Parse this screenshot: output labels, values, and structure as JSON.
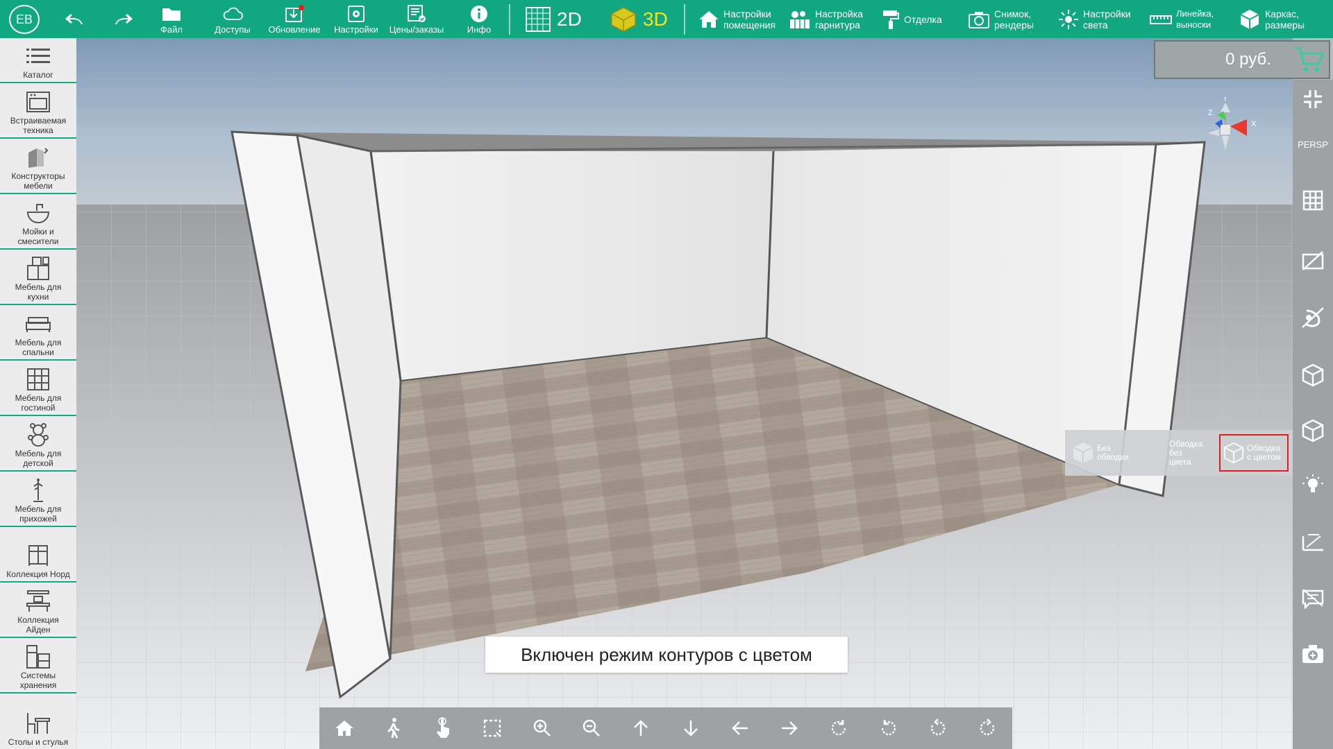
{
  "user": {
    "initials": "EB"
  },
  "topbar": {
    "file": "Файл",
    "access": "Доступы",
    "update": "Обновление",
    "settings": "Настройки",
    "prices": "Цены/заказы",
    "info": "Инфо",
    "mode_2d": "2D",
    "mode_3d": "3D",
    "room_settings": "Настройки\nпомещения",
    "hardware_settings": "Настройка\nгарнитура",
    "finishing": "Отделка",
    "snapshot": "Снимок,\nрендеры",
    "light_settings": "Настройки\nсвета",
    "ruler": "Линейка,\nвыноски",
    "frame": "Каркас,\nразмеры"
  },
  "sidebar": {
    "items": [
      {
        "label": "Каталог"
      },
      {
        "label": "Встраиваемая\nтехника"
      },
      {
        "label": "Конструкторы\nмебели"
      },
      {
        "label": "Мойки и\nсмесители"
      },
      {
        "label": "Мебель для\nкухни"
      },
      {
        "label": "Мебель для\nспальни"
      },
      {
        "label": "Мебель для\nгостиной"
      },
      {
        "label": "Мебель для\nдетской"
      },
      {
        "label": "Мебель для\nприхожей"
      },
      {
        "label": "Коллекция Норд"
      },
      {
        "label": "Коллекция\nАйден"
      },
      {
        "label": "Системы\nхранения"
      },
      {
        "label": "Столы и стулья"
      }
    ]
  },
  "price": {
    "value": "0 руб."
  },
  "rightbar": {
    "persp": "PERSP"
  },
  "gizmo": {
    "x": "X",
    "y": "Y",
    "z": "Z"
  },
  "outline_popup": {
    "no_outline": "Без\nобводки",
    "outline_no_color": "Обводка\nбез\nцвета",
    "outline_color": "Обводка\nс цветом"
  },
  "status": {
    "message": "Включен режим контуров с цветом"
  },
  "colors": {
    "brand": "#11a881",
    "accent_3d": "#f0e61a",
    "selection": "#e01c1c"
  }
}
